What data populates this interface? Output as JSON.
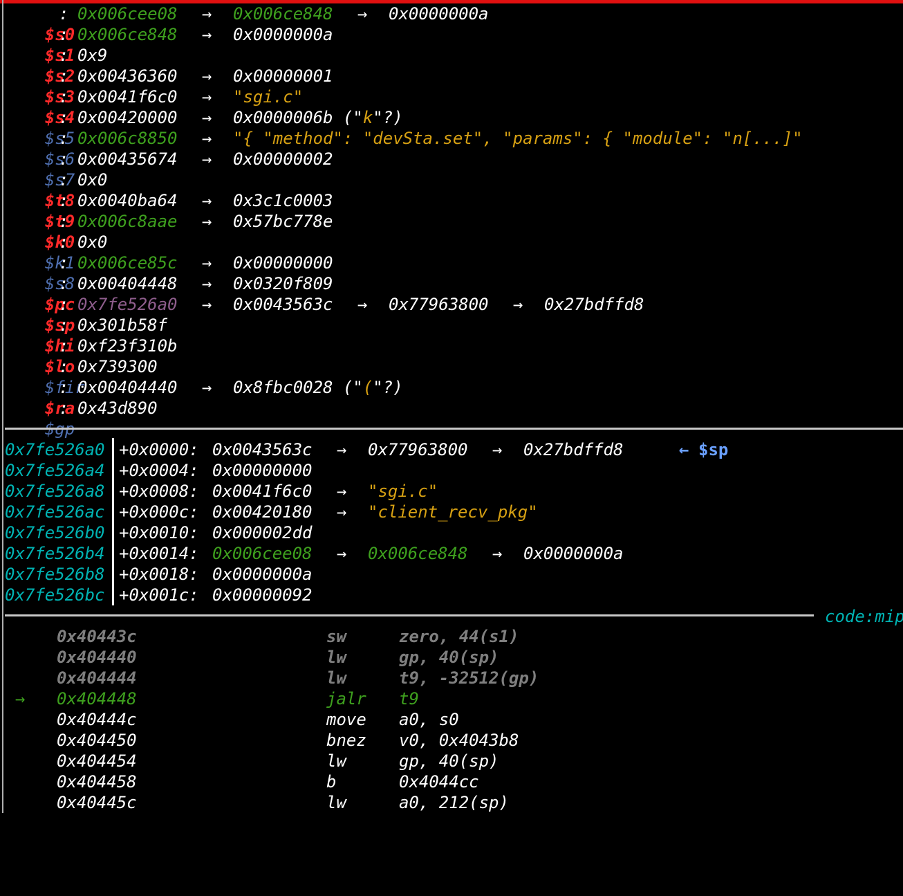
{
  "arrow": "→",
  "back_arrow": "←",
  "colors": {
    "register_red": "#ff2a2a",
    "register_blue": "#4f6fb0",
    "green": "#3ea01e",
    "string": "#d6a013",
    "stack_addr": "#00b3b3",
    "purple": "#8e5d8c"
  },
  "registers": [
    {
      "name": "$s0",
      "sep": ":",
      "val": "0x006cee08",
      "chain": [
        "0x006ce848",
        "0x0000000a"
      ]
    },
    {
      "name": "$s1",
      "sep": ":",
      "val": "0x006ce848",
      "chain": [
        "0x0000000a"
      ]
    },
    {
      "name": "$s2",
      "sep": ":",
      "val": "0x9",
      "chain": []
    },
    {
      "name": "$s3",
      "sep": ":",
      "val": "0x00436360",
      "chain": [
        "0x00000001"
      ]
    },
    {
      "name": "$s4",
      "sep": ":",
      "val": "0x0041f6c0",
      "chain": [
        "\"sgi.c\""
      ]
    },
    {
      "name": "$s5",
      "sep": ":",
      "val": "0x00420000",
      "chain": [
        "0x0000006b (\"k\"?)"
      ],
      "char_open": "0x0000006b (\"",
      "char_val": "k",
      "char_close": "\"?)"
    },
    {
      "name": "$s6",
      "sep": ":",
      "val": "0x006c8850",
      "chain": [
        "\"{ \"method\": \"devSta.set\", \"params\": { \"module\": \"n[...]\""
      ]
    },
    {
      "name": "$s7",
      "sep": ":",
      "val": "0x00435674",
      "chain": [
        "0x00000002"
      ]
    },
    {
      "name": "$t8",
      "sep": ":",
      "val": "0x0",
      "chain": []
    },
    {
      "name": "$t9",
      "sep": ":",
      "val": "0x0040ba64",
      "chain": [
        "0x3c1c0003"
      ]
    },
    {
      "name": "$k0",
      "sep": ":",
      "val": "0x006c8aae",
      "chain": [
        "0x57bc778e"
      ]
    },
    {
      "name": "$k1",
      "sep": ":",
      "val": "0x0",
      "chain": []
    },
    {
      "name": "$s8",
      "sep": ":",
      "val": "0x006ce85c",
      "chain": [
        "0x00000000"
      ]
    },
    {
      "name": "$pc",
      "sep": ":",
      "val": "0x00404448",
      "chain": [
        "0x0320f809"
      ]
    },
    {
      "name": "$sp",
      "sep": ":",
      "val": "0x7fe526a0",
      "chain": [
        "0x0043563c",
        "0x77963800",
        "0x27bdffd8"
      ]
    },
    {
      "name": "$hi",
      "sep": ":",
      "val": "0x301b58f",
      "chain": []
    },
    {
      "name": "$lo",
      "sep": ":",
      "val": "0xf23f310b",
      "chain": []
    },
    {
      "name": "$fir",
      "sep": ":",
      "val": "0x739300",
      "chain": []
    },
    {
      "name": "$ra",
      "sep": ":",
      "val": "0x00404440",
      "chain": [
        "0x8fbc0028 (\"(\"?)"
      ],
      "char_open": "0x8fbc0028 (\"",
      "char_val": "(",
      "char_close": "\"?)"
    },
    {
      "name": "$gp",
      "sep": ":",
      "val": "0x43d890",
      "chain": []
    }
  ],
  "stack": [
    {
      "addr": "0x7fe526a0",
      "off": "+0x0000:",
      "val": "0x0043563c",
      "chain": [
        "0x77963800",
        "0x27bdffd8"
      ],
      "tag": "$sp"
    },
    {
      "addr": "0x7fe526a4",
      "off": "+0x0004:",
      "val": "0x00000000",
      "chain": []
    },
    {
      "addr": "0x7fe526a8",
      "off": "+0x0008:",
      "val": "0x0041f6c0",
      "chain": [
        "\"sgi.c\""
      ]
    },
    {
      "addr": "0x7fe526ac",
      "off": "+0x000c:",
      "val": "0x00420180",
      "chain": [
        "\"client_recv_pkg\""
      ]
    },
    {
      "addr": "0x7fe526b0",
      "off": "+0x0010:",
      "val": "0x000002dd",
      "chain": []
    },
    {
      "addr": "0x7fe526b4",
      "off": "+0x0014:",
      "val": "0x006cee08",
      "chain": [
        "0x006ce848",
        "0x0000000a"
      ]
    },
    {
      "addr": "0x7fe526b8",
      "off": "+0x0018:",
      "val": "0x0000000a",
      "chain": []
    },
    {
      "addr": "0x7fe526bc",
      "off": "+0x001c:",
      "val": "0x00000092",
      "chain": []
    }
  ],
  "code_header": "code:mip",
  "code": [
    {
      "addr": "0x40443c",
      "op": "sw",
      "args": "zero, 44(s1)",
      "state": "past"
    },
    {
      "addr": "0x404440",
      "op": "lw",
      "args": "gp, 40(sp)",
      "state": "past"
    },
    {
      "addr": "0x404444",
      "op": "lw",
      "args": "t9, -32512(gp)",
      "state": "past"
    },
    {
      "addr": "0x404448",
      "op": "jalr",
      "args": "t9",
      "state": "current"
    },
    {
      "addr": "0x40444c",
      "op": "move",
      "args": "a0, s0",
      "state": "next"
    },
    {
      "addr": "0x404450",
      "op": "bnez",
      "args": "v0, 0x4043b8",
      "state": "next"
    },
    {
      "addr": "0x404454",
      "op": "lw",
      "args": "gp, 40(sp)",
      "state": "next"
    },
    {
      "addr": "0x404458",
      "op": "b",
      "args": "0x4044cc",
      "state": "next"
    },
    {
      "addr": "0x40445c",
      "op": "lw",
      "args": "a0, 212(sp)",
      "state": "next"
    }
  ]
}
